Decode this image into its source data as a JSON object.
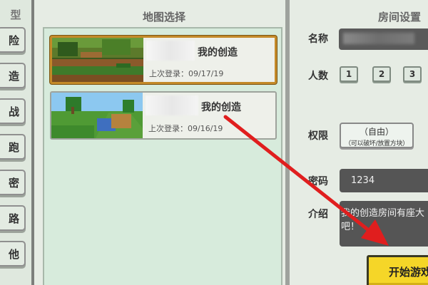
{
  "left": {
    "title": "型",
    "categories": [
      "险",
      "造",
      "战",
      "跑",
      "密",
      "路",
      "他"
    ]
  },
  "maps": {
    "title": "地图选择",
    "items": [
      {
        "name": "我的创造",
        "date": "上次登录：09/17/19",
        "selected": true
      },
      {
        "name": "我的创造",
        "date": "上次登录：09/16/19",
        "selected": false
      }
    ]
  },
  "room": {
    "title": "房间设置",
    "name_label": "名称",
    "players_label": "人数",
    "player_options": [
      "1",
      "2",
      "3"
    ],
    "permission_label": "权限",
    "permission_value": "（自由）",
    "permission_desc": "（可以破坏/放置方块）",
    "password_label": "密码",
    "password_value": "1234",
    "intro_label": "介绍",
    "intro_line1": "我的创造房间有座大",
    "intro_line2": "吧！",
    "start_button": "开始游戏"
  },
  "colors": {
    "selected_border": "#c48a29",
    "start_button": "#f5d628",
    "annotation_arrow": "#e01e1e"
  }
}
